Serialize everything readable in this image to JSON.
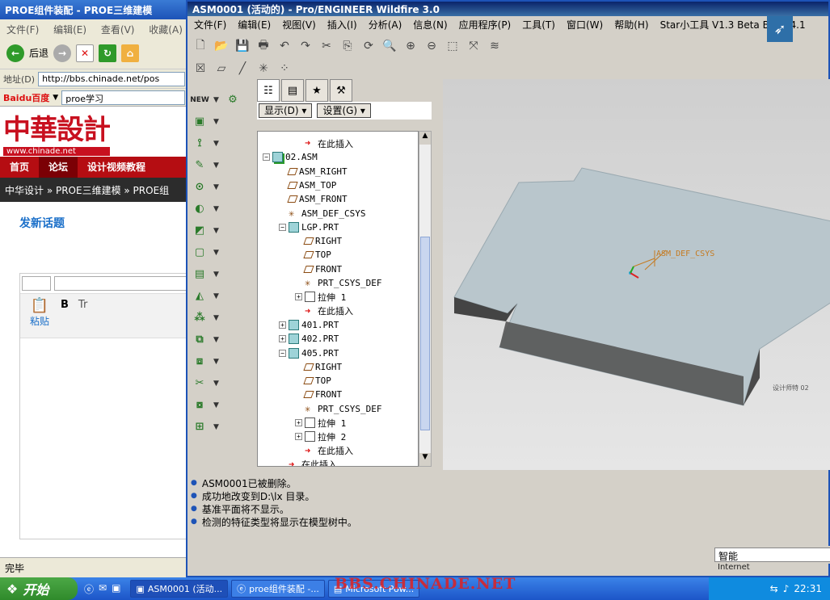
{
  "ie": {
    "title": "PROE组件装配 - PROE三维建模",
    "menu": [
      "文件(F)",
      "编辑(E)",
      "查看(V)",
      "收藏(A)"
    ],
    "back_label": "后退",
    "address_label": "地址(D)",
    "address_value": "http://bbs.chinade.net/pos",
    "baidu_text": "Baidu百度",
    "search_value": "proe学习",
    "site_logo": "中華設計",
    "site_url": "www.chinade.net",
    "nav": [
      "首页",
      "论坛",
      "设计视频教程"
    ],
    "breadcrumb": "中华设计 » PROE三维建模 » PROE组",
    "post_title": "发新话题",
    "paste_label": "粘贴",
    "status": "完毕"
  },
  "pro": {
    "title": "ASM0001 (活动的) - Pro/ENGINEER Wildfire 3.0",
    "menu": [
      "文件(F)",
      "编辑(E)",
      "视图(V)",
      "插入(I)",
      "分析(A)",
      "信息(N)",
      "应用程序(P)",
      "工具(T)",
      "窗口(W)",
      "帮助(H)",
      "Star小工具 V1.3 Beta Build 4.1"
    ],
    "panel_buttons": {
      "show": "显示(D) ▾",
      "settings": "设置(G) ▾"
    },
    "tree": [
      {
        "label": "在此插入",
        "icon": "insert-arrow-icon",
        "indent": 3,
        "pm": ""
      },
      {
        "label": "02.ASM",
        "icon": "assembly-icon",
        "indent": 1,
        "pm": "−"
      },
      {
        "label": "ASM_RIGHT",
        "icon": "datum-plane-icon",
        "indent": 2,
        "pm": ""
      },
      {
        "label": "ASM_TOP",
        "icon": "datum-plane-icon",
        "indent": 2,
        "pm": ""
      },
      {
        "label": "ASM_FRONT",
        "icon": "datum-plane-icon",
        "indent": 2,
        "pm": ""
      },
      {
        "label": "ASM_DEF_CSYS",
        "icon": "csys-icon",
        "indent": 2,
        "pm": ""
      },
      {
        "label": "LGP.PRT",
        "icon": "part-icon",
        "indent": 2,
        "pm": "−"
      },
      {
        "label": "RIGHT",
        "icon": "datum-plane-icon",
        "indent": 3,
        "pm": ""
      },
      {
        "label": "TOP",
        "icon": "datum-plane-icon",
        "indent": 3,
        "pm": ""
      },
      {
        "label": "FRONT",
        "icon": "datum-plane-icon",
        "indent": 3,
        "pm": ""
      },
      {
        "label": "PRT_CSYS_DEF",
        "icon": "csys-icon",
        "indent": 3,
        "pm": ""
      },
      {
        "label": "拉伸 1",
        "icon": "extrude-icon",
        "indent": 3,
        "pm": "+"
      },
      {
        "label": "在此插入",
        "icon": "insert-arrow-icon",
        "indent": 3,
        "pm": ""
      },
      {
        "label": "401.PRT",
        "icon": "part-icon",
        "indent": 2,
        "pm": "+"
      },
      {
        "label": "402.PRT",
        "icon": "part-icon",
        "indent": 2,
        "pm": "+"
      },
      {
        "label": "405.PRT",
        "icon": "part-icon",
        "indent": 2,
        "pm": "−"
      },
      {
        "label": "RIGHT",
        "icon": "datum-plane-icon",
        "indent": 3,
        "pm": ""
      },
      {
        "label": "TOP",
        "icon": "datum-plane-icon",
        "indent": 3,
        "pm": ""
      },
      {
        "label": "FRONT",
        "icon": "datum-plane-icon",
        "indent": 3,
        "pm": ""
      },
      {
        "label": "PRT_CSYS_DEF",
        "icon": "csys-icon",
        "indent": 3,
        "pm": ""
      },
      {
        "label": "拉伸 1",
        "icon": "extrude-icon",
        "indent": 3,
        "pm": "+"
      },
      {
        "label": "拉伸 2",
        "icon": "extrude-icon",
        "indent": 3,
        "pm": "+"
      },
      {
        "label": "在此插入",
        "icon": "insert-arrow-icon",
        "indent": 3,
        "pm": ""
      },
      {
        "label": "在此插入",
        "icon": "insert-arrow-icon",
        "indent": 2,
        "pm": ""
      }
    ],
    "csys_label": "ASM_DEF_CSYS",
    "corner_label": "设计师特 02",
    "messages": [
      "ASM0001已被删除。",
      "成功地改变到D:\\lx 目录。",
      "基准平面将不显示。",
      "检测的特征类型将显示在模型树中。"
    ],
    "smart": "智能"
  },
  "taskbar": {
    "start": "开始",
    "tasks": [
      "ASM0001 (活动...",
      "proe组件装配 -...",
      "Microsoft Pow..."
    ],
    "watermark": "BBS.CHINADE.NET",
    "internet": "Internet",
    "clock": "22:31"
  },
  "colors": {
    "accent": "#c8101f",
    "title_blue": "#0a246a",
    "model_face": "#b9c6cc"
  }
}
